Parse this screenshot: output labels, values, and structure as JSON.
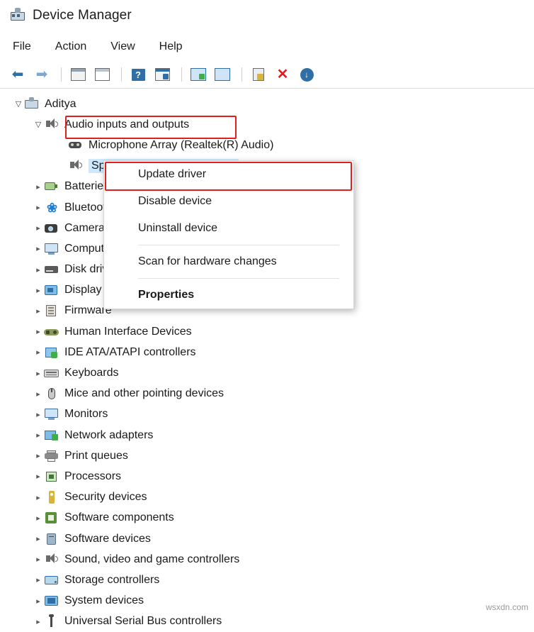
{
  "window": {
    "title": "Device Manager",
    "icon": "device-manager-icon"
  },
  "menubar": {
    "items": [
      {
        "label": "File"
      },
      {
        "label": "Action"
      },
      {
        "label": "View"
      },
      {
        "label": "Help"
      }
    ]
  },
  "toolbar": {
    "buttons": [
      {
        "name": "back-button",
        "glyph": "←"
      },
      {
        "name": "forward-button",
        "glyph": "→"
      },
      {
        "name": "up-one-level-button",
        "glyph": "list-icon"
      },
      {
        "name": "properties-button",
        "glyph": "properties-icon"
      },
      {
        "name": "help-button",
        "glyph": "?"
      },
      {
        "name": "show-hidden-devices-button",
        "glyph": "details-icon"
      },
      {
        "name": "scan-for-hardware-changes-button",
        "glyph": "scan-icon"
      },
      {
        "name": "view-devices-button",
        "glyph": "monitor-icon"
      },
      {
        "name": "update-driver-button",
        "glyph": "update-driver-icon"
      },
      {
        "name": "uninstall-device-button",
        "glyph": "✕"
      },
      {
        "name": "disable-device-button",
        "glyph": "↓"
      }
    ]
  },
  "tree": {
    "root": {
      "label": "Aditya",
      "icon": "computer-icon",
      "expanded": true
    },
    "nodes": [
      {
        "label": "Audio inputs and outputs",
        "icon": "speaker-icon",
        "expanded": true,
        "indent": 1,
        "highlighted": true
      },
      {
        "label": "Microphone Array (Realtek(R) Audio)",
        "icon": "microphone-icon",
        "indent": 2,
        "leaf": true
      },
      {
        "label": "Speakers (Realtek(R) Audio)",
        "icon": "speaker-icon",
        "indent": 2,
        "leaf": true,
        "selected": true
      },
      {
        "label": "Batteries",
        "icon": "battery-icon",
        "indent": 1
      },
      {
        "label": "Bluetooth",
        "icon": "bluetooth-icon",
        "indent": 1
      },
      {
        "label": "Cameras",
        "icon": "camera-icon",
        "indent": 1
      },
      {
        "label": "Computer",
        "icon": "computer-icon",
        "indent": 1
      },
      {
        "label": "Disk drives",
        "icon": "disk-icon",
        "indent": 1
      },
      {
        "label": "Display adapters",
        "icon": "display-adapter-icon",
        "indent": 1
      },
      {
        "label": "Firmware",
        "icon": "firmware-icon",
        "indent": 1
      },
      {
        "label": "Human Interface Devices",
        "icon": "hid-icon",
        "indent": 1
      },
      {
        "label": "IDE ATA/ATAPI controllers",
        "icon": "ide-controller-icon",
        "indent": 1
      },
      {
        "label": "Keyboards",
        "icon": "keyboard-icon",
        "indent": 1
      },
      {
        "label": "Mice and other pointing devices",
        "icon": "mouse-icon",
        "indent": 1
      },
      {
        "label": "Monitors",
        "icon": "monitor-icon",
        "indent": 1
      },
      {
        "label": "Network adapters",
        "icon": "network-adapter-icon",
        "indent": 1
      },
      {
        "label": "Print queues",
        "icon": "printer-icon",
        "indent": 1
      },
      {
        "label": "Processors",
        "icon": "processor-icon",
        "indent": 1
      },
      {
        "label": "Security devices",
        "icon": "security-device-icon",
        "indent": 1
      },
      {
        "label": "Software components",
        "icon": "software-component-icon",
        "indent": 1
      },
      {
        "label": "Software devices",
        "icon": "software-device-icon",
        "indent": 1
      },
      {
        "label": "Sound, video and game controllers",
        "icon": "speaker-icon",
        "indent": 1
      },
      {
        "label": "Storage controllers",
        "icon": "storage-controller-icon",
        "indent": 1
      },
      {
        "label": "System devices",
        "icon": "system-device-icon",
        "indent": 1
      },
      {
        "label": "Universal Serial Bus controllers",
        "icon": "usb-icon",
        "indent": 1
      }
    ]
  },
  "context_menu": {
    "items": [
      {
        "label": "Update driver",
        "bold": false,
        "highlighted": true
      },
      {
        "label": "Disable device",
        "bold": false
      },
      {
        "label": "Uninstall device",
        "bold": false
      },
      {
        "separator": true
      },
      {
        "label": "Scan for hardware changes",
        "bold": false
      },
      {
        "separator": true
      },
      {
        "label": "Properties",
        "bold": true
      }
    ]
  },
  "annotations": {
    "highlight_color": "#e02020",
    "boxes": [
      {
        "name": "audio-node-highlight"
      },
      {
        "name": "update-driver-highlight"
      }
    ]
  },
  "watermark": {
    "text": "wsxdn.com"
  }
}
